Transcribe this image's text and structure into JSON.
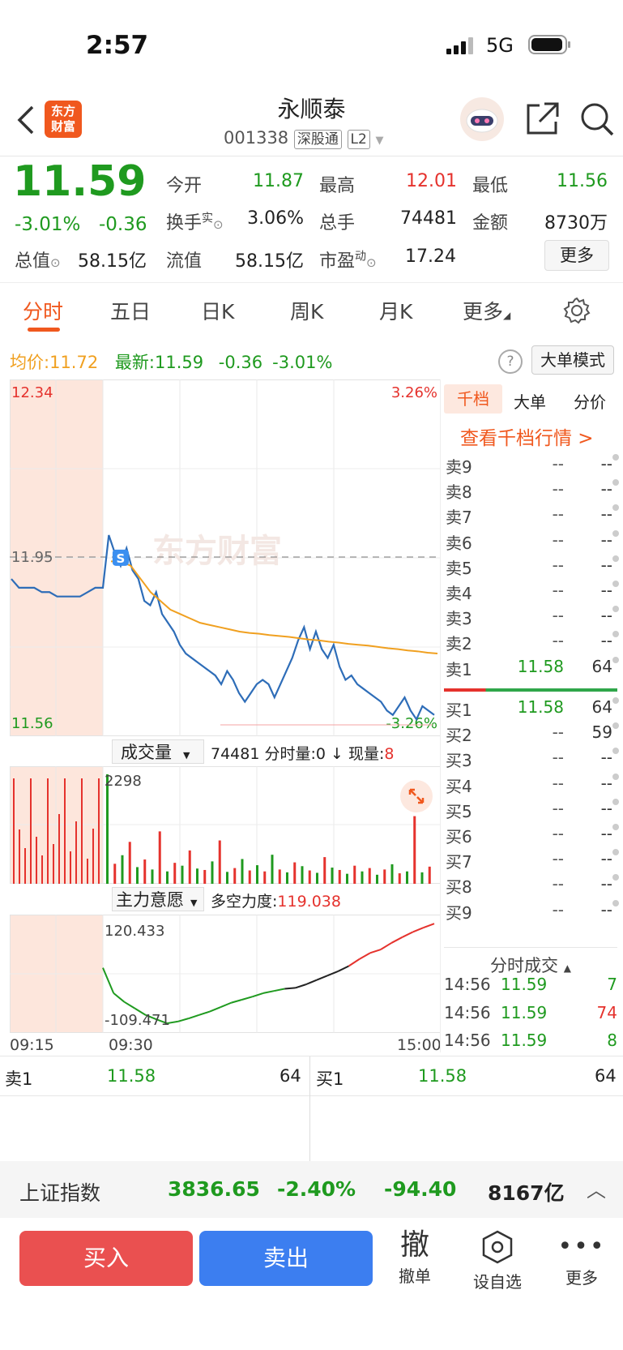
{
  "status": {
    "time": "2:57",
    "network": "5G"
  },
  "header": {
    "logo_line1": "东方",
    "logo_line2": "财富",
    "title": "永顺泰",
    "code": "001338",
    "tag_connect": "深股通",
    "tag_level": "L2"
  },
  "quote": {
    "price": "11.59",
    "change_pct": "-3.01%",
    "change": "-0.36",
    "open_label": "今开",
    "open": "11.87",
    "high_label": "最高",
    "high": "12.01",
    "low_label": "最低",
    "low": "11.56",
    "turnover_label": "换手",
    "turnover_sup": "实",
    "turnover": "3.06%",
    "volume_label": "总手",
    "volume": "74481",
    "amount_label": "金额",
    "amount": "8730万",
    "mktcap_label": "总值",
    "mktcap": "58.15亿",
    "float_label": "流值",
    "float": "58.15亿",
    "pe_label": "市盈",
    "pe_sup": "动",
    "pe": "17.24",
    "more_button": "更多"
  },
  "tabs": [
    "分时",
    "五日",
    "日K",
    "周K",
    "月K",
    "更多"
  ],
  "summary": {
    "avg_label": "均价:",
    "avg": "11.72",
    "latest_label": "最新:",
    "latest": "11.59",
    "change": "-0.36",
    "change_pct": "-3.01%",
    "big_order_mode": "大单模式"
  },
  "chart_data": [
    {
      "type": "line",
      "name_note": "intraday price",
      "y_top_label": "12.34",
      "y_bottom_label": "11.56",
      "y_mid_label": "11.95",
      "pct_top_label": "3.26%",
      "pct_bottom_label": "-3.26%",
      "ylim": [
        11.56,
        12.34
      ],
      "prev_close": 11.95,
      "x_labels": [
        "09:15",
        "09:30",
        "15:00"
      ],
      "watermark": "东方财富",
      "price": [
        11.9,
        11.88,
        11.88,
        11.88,
        11.87,
        11.87,
        11.86,
        11.86,
        11.86,
        11.86,
        11.87,
        11.88,
        11.88,
        12.0,
        11.96,
        11.93,
        11.97,
        11.92,
        11.9,
        11.85,
        11.84,
        11.87,
        11.82,
        11.8,
        11.78,
        11.75,
        11.73,
        11.72,
        11.71,
        11.7,
        11.69,
        11.68,
        11.66,
        11.69,
        11.67,
        11.64,
        11.62,
        11.64,
        11.66,
        11.67,
        11.66,
        11.63,
        11.66,
        11.69,
        11.72,
        11.76,
        11.79,
        11.74,
        11.78,
        11.74,
        11.72,
        11.75,
        11.7,
        11.67,
        11.68,
        11.66,
        11.65,
        11.64,
        11.63,
        11.62,
        11.6,
        11.59,
        11.61,
        11.63,
        11.6,
        11.58,
        11.61,
        11.6,
        11.59
      ],
      "avg": [
        11.94,
        11.94,
        11.93,
        11.9,
        11.87,
        11.85,
        11.83,
        11.82,
        11.81,
        11.8,
        11.795,
        11.79,
        11.785,
        11.78,
        11.777,
        11.775,
        11.772,
        11.77,
        11.768,
        11.765,
        11.762,
        11.76,
        11.757,
        11.755,
        11.752,
        11.75,
        11.748,
        11.745,
        11.742,
        11.74,
        11.737,
        11.735,
        11.732,
        11.73
      ],
      "marker": "S"
    },
    {
      "type": "bar",
      "title": "成交量",
      "total": "74481",
      "minute_vol_label": "分时量:",
      "minute_vol": "0",
      "current_vol_label": "现量:",
      "current_vol": "8",
      "y_top_label": "2298",
      "values": [
        2298,
        420,
        600,
        880,
        350,
        510,
        300,
        1100,
        260,
        440,
        380,
        700,
        320,
        290,
        470,
        910,
        250,
        330,
        520,
        280,
        390,
        260,
        610,
        300,
        240,
        450,
        370,
        280,
        230,
        560,
        340,
        290,
        210,
        380,
        260,
        330,
        190,
        300,
        410,
        220,
        260,
        1420,
        240,
        360
      ]
    },
    {
      "type": "line",
      "title": "主力意愿",
      "force_label": "多空力度:",
      "force_value": "119.038",
      "y_top_label": "120.433",
      "y_bottom_label": "-109.471",
      "ylim": [
        -120,
        125
      ],
      "values": [
        18,
        -40,
        -60,
        -75,
        -90,
        -100,
        -109,
        -105,
        -98,
        -90,
        -82,
        -72,
        -62,
        -55,
        -48,
        -40,
        -35,
        -30,
        -28,
        -20,
        -10,
        0,
        10,
        22,
        38,
        52,
        60,
        75,
        88,
        100,
        110,
        119
      ]
    }
  ],
  "orderbook": {
    "tabs": [
      "千档",
      "大单",
      "分价"
    ],
    "link": "查看千档行情 >",
    "asks": [
      {
        "label": "卖9",
        "price": "--",
        "vol": "--"
      },
      {
        "label": "卖8",
        "price": "--",
        "vol": "--"
      },
      {
        "label": "卖7",
        "price": "--",
        "vol": "--"
      },
      {
        "label": "卖6",
        "price": "--",
        "vol": "--"
      },
      {
        "label": "卖5",
        "price": "--",
        "vol": "--"
      },
      {
        "label": "卖4",
        "price": "--",
        "vol": "--"
      },
      {
        "label": "卖3",
        "price": "--",
        "vol": "--"
      },
      {
        "label": "卖2",
        "price": "--",
        "vol": "--"
      },
      {
        "label": "卖1",
        "price": "11.58",
        "vol": "64"
      }
    ],
    "bids": [
      {
        "label": "买1",
        "price": "11.58",
        "vol": "64"
      },
      {
        "label": "买2",
        "price": "--",
        "vol": "59"
      },
      {
        "label": "买3",
        "price": "--",
        "vol": "--"
      },
      {
        "label": "买4",
        "price": "--",
        "vol": "--"
      },
      {
        "label": "买5",
        "price": "--",
        "vol": "--"
      },
      {
        "label": "买6",
        "price": "--",
        "vol": "--"
      },
      {
        "label": "买7",
        "price": "--",
        "vol": "--"
      },
      {
        "label": "买8",
        "price": "--",
        "vol": "--"
      },
      {
        "label": "买9",
        "price": "--",
        "vol": "--"
      }
    ]
  },
  "ticks": {
    "title": "分时成交",
    "rows": [
      {
        "time": "14:56",
        "price": "11.59",
        "vol": "7",
        "dir": "sell"
      },
      {
        "time": "14:56",
        "price": "11.59",
        "vol": "74",
        "dir": "buy"
      },
      {
        "time": "14:56",
        "price": "11.59",
        "vol": "8",
        "dir": "sell"
      }
    ]
  },
  "level1": {
    "ask_label": "卖1",
    "ask_price": "11.58",
    "ask_vol": "64",
    "bid_label": "买1",
    "bid_price": "11.58",
    "bid_vol": "64"
  },
  "index": {
    "name": "上证指数",
    "value": "3836.65",
    "change_pct": "-2.40%",
    "change": "-94.40",
    "amount": "8167亿"
  },
  "actions": {
    "buy": "买入",
    "sell": "卖出",
    "cancel_icon": "撤",
    "cancel": "撤单",
    "watch": "设自选",
    "more": "更多"
  },
  "colors": {
    "up": "#e5322d",
    "down": "#1f9a1f",
    "avg_line": "#f0a020",
    "price_line": "#2e6db8",
    "brand": "#f0581e",
    "buy_btn": "#ea5050",
    "sell_btn": "#3c7ef0"
  }
}
